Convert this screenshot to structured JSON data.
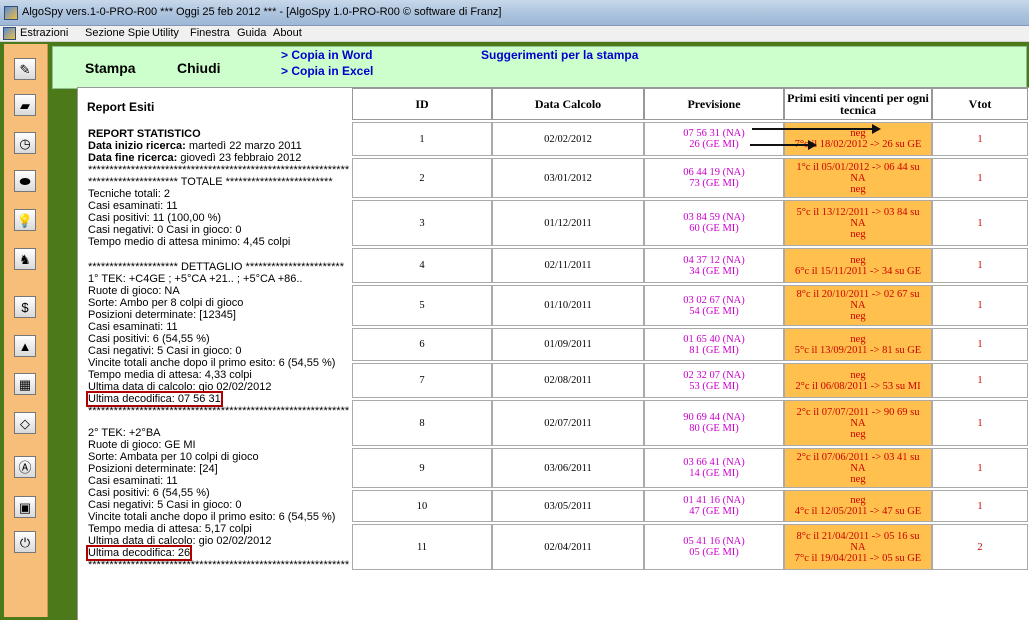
{
  "window": {
    "title": "AlgoSpy vers.1-0-PRO-R00  *** Oggi 25 feb 2012 ***  - [AlgoSpy 1.0-PRO-R00   © software di Franz]"
  },
  "menu": [
    "Estrazioni",
    "Sezione Spie",
    "Utility",
    "Finestra",
    "Guida",
    "About"
  ],
  "sidebar_icons": [
    "pencil-icon",
    "book-icon",
    "clock-icon",
    "pill-icon",
    "lightbulb-icon",
    "joystick-icon",
    "dollar-icon",
    "pyramid-icon",
    "calendar-icon",
    "drop-icon",
    "letter-a-icon",
    "screen-icon",
    "power-icon"
  ],
  "toolbar": {
    "stampa": "Stampa",
    "chiudi": "Chiudi",
    "copia_word": "> Copia in Word",
    "copia_excel": "> Copia in Excel",
    "suggerimenti": "Suggerimenti per la stampa"
  },
  "report": {
    "title": "Report Esiti",
    "lines": [
      "REPORT STATISTICO",
      "Data inizio ricerca: martedì 22 marzo 2011",
      "Data fine ricerca: giovedì 23 febbraio 2012",
      "*************************************************************",
      "********************* TOTALE *************************",
      "Tecniche totali: 2",
      "Casi esaminati: 11",
      "Casi positivi: 11 (100,00 %)",
      "Casi negativi: 0 Casi in gioco: 0",
      "Tempo medio di attesa minimo: 4,45 colpi",
      "",
      "********************* DETTAGLIO ***********************",
      "1° TEK: +C4GE ; +5°CA +21.. ; +5°CA +86..",
      "Ruote di gioco: NA",
      "Sorte: Ambo per 8 colpi di gioco",
      "Posizioni determinate: [12345]",
      "Casi esaminati: 11",
      "Casi positivi: 6 (54,55 %)",
      "Casi negativi: 5 Casi in gioco: 0",
      "Vincite totali anche dopo il primo esito: 6 (54,55 %)",
      "Tempo media di attesa: 4,33 colpi",
      "Ultima data di calcolo: gio 02/02/2012",
      "Ultima decodifica: 07 56 31",
      "*************************************************************",
      "2° TEK: +2°BA",
      "Ruote di gioco: GE MI",
      "Sorte: Ambata per 10 colpi di gioco",
      "Posizioni determinate: [24]",
      "Casi esaminati: 11",
      "Casi positivi: 6 (54,55 %)",
      "Casi negativi: 5 Casi in gioco: 0",
      "Vincite totali anche dopo il primo esito: 6 (54,55 %)",
      "Tempo media di attesa: 5,17 colpi",
      "Ultima data di calcolo: gio 02/02/2012",
      "Ultima decodifica: 26",
      "*************************************************************"
    ]
  },
  "table": {
    "headers": [
      "ID",
      "Data Calcolo",
      "Previsione",
      "Primi esiti vincenti per ogni tecnica",
      "Vtot"
    ],
    "rows": [
      {
        "id": "1",
        "data": "02/02/2012",
        "prev": [
          "07 56 31 (NA)",
          "26 (GE MI)"
        ],
        "esiti": [
          "neg",
          "7°c il 18/02/2012 -> 26 su GE"
        ],
        "vtot": "1"
      },
      {
        "id": "2",
        "data": "03/01/2012",
        "prev": [
          "06 44 19 (NA)",
          "73 (GE MI)"
        ],
        "esiti": [
          "1°c il 05/01/2012 -> 06 44 su",
          "NA",
          "neg"
        ],
        "vtot": "1"
      },
      {
        "id": "3",
        "data": "01/12/2011",
        "prev": [
          "03 84 59 (NA)",
          "60 (GE MI)"
        ],
        "esiti": [
          "5°c il 13/12/2011 -> 03 84 su",
          "NA",
          "neg"
        ],
        "vtot": "1"
      },
      {
        "id": "4",
        "data": "02/11/2011",
        "prev": [
          "04 37 12 (NA)",
          "34 (GE MI)"
        ],
        "esiti": [
          "neg",
          "6°c il 15/11/2011 -> 34 su GE"
        ],
        "vtot": "1"
      },
      {
        "id": "5",
        "data": "01/10/2011",
        "prev": [
          "03 02 67 (NA)",
          "54 (GE MI)"
        ],
        "esiti": [
          "8°c il 20/10/2011 -> 02 67 su",
          "NA",
          "neg"
        ],
        "vtot": "1"
      },
      {
        "id": "6",
        "data": "01/09/2011",
        "prev": [
          "01 65 40 (NA)",
          "81 (GE MI)"
        ],
        "esiti": [
          "neg",
          "5°c il 13/09/2011 -> 81 su GE"
        ],
        "vtot": "1"
      },
      {
        "id": "7",
        "data": "02/08/2011",
        "prev": [
          "02 32 07 (NA)",
          "53 (GE MI)"
        ],
        "esiti": [
          "neg",
          "2°c il 06/08/2011 -> 53 su MI"
        ],
        "vtot": "1"
      },
      {
        "id": "8",
        "data": "02/07/2011",
        "prev": [
          "90 69 44 (NA)",
          "80 (GE MI)"
        ],
        "esiti": [
          "2°c il 07/07/2011 -> 90 69 su",
          "NA",
          "neg"
        ],
        "vtot": "1"
      },
      {
        "id": "9",
        "data": "03/06/2011",
        "prev": [
          "03 66 41 (NA)",
          "14 (GE MI)"
        ],
        "esiti": [
          "2°c il 07/06/2011 -> 03 41 su",
          "NA",
          "neg"
        ],
        "vtot": "1"
      },
      {
        "id": "10",
        "data": "03/05/2011",
        "prev": [
          "01 41 16 (NA)",
          "47 (GE MI)"
        ],
        "esiti": [
          "neg",
          "4°c il 12/05/2011 -> 47 su GE"
        ],
        "vtot": "1"
      },
      {
        "id": "11",
        "data": "02/04/2011",
        "prev": [
          "05 41 16 (NA)",
          "05 (GE MI)"
        ],
        "esiti": [
          "8°c il 21/04/2011 -> 05 16 su",
          "NA",
          "7°c il 19/04/2011 -> 05 su GE"
        ],
        "vtot": "2"
      }
    ]
  }
}
